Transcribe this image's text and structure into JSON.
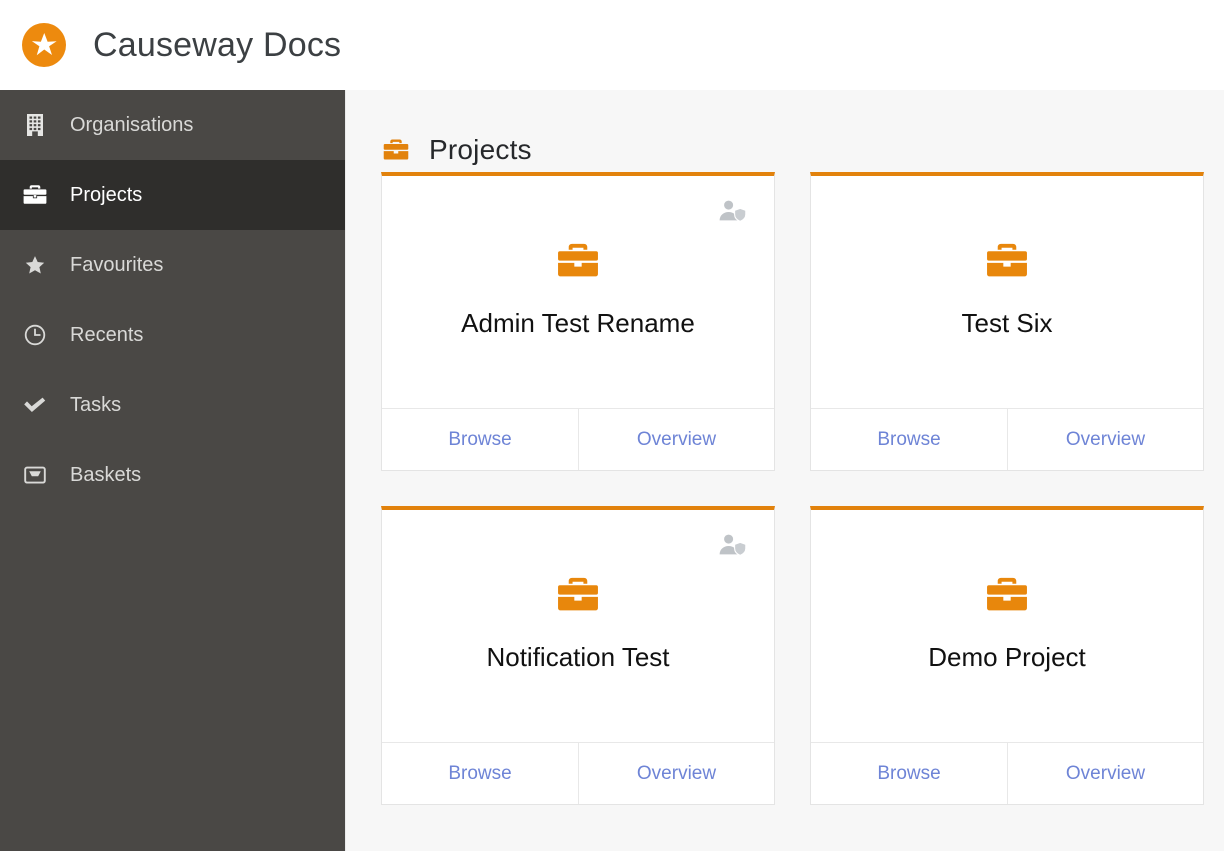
{
  "header": {
    "title": "Causeway Docs",
    "logo_icon": "star-circle-logo",
    "brand_color": "#ED8A0E"
  },
  "sidebar": {
    "background_color": "#4A4845",
    "active_background_color": "#2F2E2C",
    "items": [
      {
        "label": "Organisations",
        "icon": "building-icon",
        "active": false
      },
      {
        "label": "Projects",
        "icon": "briefcase-icon",
        "active": true
      },
      {
        "label": "Favourites",
        "icon": "star-icon",
        "active": false
      },
      {
        "label": "Recents",
        "icon": "clock-icon",
        "active": false
      },
      {
        "label": "Tasks",
        "icon": "check-icon",
        "active": false
      },
      {
        "label": "Baskets",
        "icon": "inbox-icon",
        "active": false
      }
    ]
  },
  "main": {
    "page_title": "Projects",
    "page_icon": "briefcase-icon",
    "accent_color": "#E2820C",
    "link_color": "#6E84D6",
    "browse_label": "Browse",
    "overview_label": "Overview",
    "admin_badge_icon": "user-shield-icon",
    "cards": [
      {
        "title": "Admin Test Rename",
        "icon": "briefcase-icon",
        "has_admin_badge": true,
        "browse_label": "Browse",
        "overview_label": "Overview"
      },
      {
        "title": "Test Six",
        "icon": "briefcase-icon",
        "has_admin_badge": false,
        "browse_label": "Browse",
        "overview_label": "Overview"
      },
      {
        "title": "Notification Test",
        "icon": "briefcase-icon",
        "has_admin_badge": true,
        "browse_label": "Browse",
        "overview_label": "Overview"
      },
      {
        "title": "Demo Project",
        "icon": "briefcase-icon",
        "has_admin_badge": false,
        "browse_label": "Browse",
        "overview_label": "Overview"
      }
    ]
  }
}
